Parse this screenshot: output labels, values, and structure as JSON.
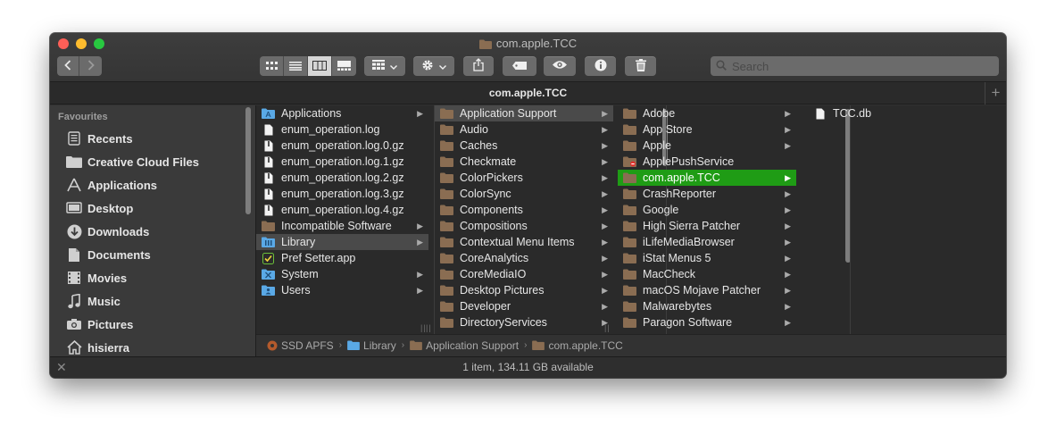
{
  "window": {
    "title": "com.apple.TCC"
  },
  "toolbar": {
    "view_buttons": [
      "icon-view-icon",
      "list-view-icon",
      "column-view-icon",
      "gallery-view-icon"
    ],
    "active_view": "column-view-icon",
    "search_placeholder": "Search"
  },
  "tab": {
    "title": "com.apple.TCC",
    "add": "+"
  },
  "sidebar": {
    "heading": "Favourites",
    "items": [
      {
        "label": "Recents",
        "icon": "clock-icon"
      },
      {
        "label": "Creative Cloud Files",
        "icon": "folder-icon"
      },
      {
        "label": "Applications",
        "icon": "applications-icon"
      },
      {
        "label": "Desktop",
        "icon": "desktop-icon"
      },
      {
        "label": "Downloads",
        "icon": "downloads-icon"
      },
      {
        "label": "Documents",
        "icon": "documents-icon"
      },
      {
        "label": "Movies",
        "icon": "film-icon"
      },
      {
        "label": "Music",
        "icon": "music-note-icon"
      },
      {
        "label": "Pictures",
        "icon": "camera-icon"
      },
      {
        "label": "hisierra",
        "icon": "home-icon"
      }
    ]
  },
  "columns": {
    "col1": [
      {
        "label": "Applications",
        "kind": "app-folder",
        "chevron": true
      },
      {
        "label": "enum_operation.log",
        "kind": "file"
      },
      {
        "label": "enum_operation.log.0.gz",
        "kind": "archive"
      },
      {
        "label": "enum_operation.log.1.gz",
        "kind": "archive"
      },
      {
        "label": "enum_operation.log.2.gz",
        "kind": "archive"
      },
      {
        "label": "enum_operation.log.3.gz",
        "kind": "archive"
      },
      {
        "label": "enum_operation.log.4.gz",
        "kind": "archive"
      },
      {
        "label": "Incompatible Software",
        "kind": "folder",
        "chevron": true
      },
      {
        "label": "Library",
        "kind": "lib-folder",
        "chevron": true,
        "selected": "gray"
      },
      {
        "label": "Pref Setter.app",
        "kind": "app"
      },
      {
        "label": "System",
        "kind": "sys-folder",
        "chevron": true
      },
      {
        "label": "Users",
        "kind": "sys-folder",
        "chevron": true
      }
    ],
    "col2": [
      {
        "label": "Application Support",
        "kind": "folder",
        "chevron": true,
        "selected": "gray"
      },
      {
        "label": "Audio",
        "kind": "folder",
        "chevron": true
      },
      {
        "label": "Caches",
        "kind": "folder",
        "chevron": true
      },
      {
        "label": "Checkmate",
        "kind": "folder",
        "chevron": true
      },
      {
        "label": "ColorPickers",
        "kind": "folder",
        "chevron": true
      },
      {
        "label": "ColorSync",
        "kind": "folder",
        "chevron": true
      },
      {
        "label": "Components",
        "kind": "folder",
        "chevron": true
      },
      {
        "label": "Compositions",
        "kind": "folder",
        "chevron": true
      },
      {
        "label": "Contextual Menu Items",
        "kind": "folder",
        "chevron": true
      },
      {
        "label": "CoreAnalytics",
        "kind": "folder",
        "chevron": true
      },
      {
        "label": "CoreMediaIO",
        "kind": "folder",
        "chevron": true
      },
      {
        "label": "Desktop Pictures",
        "kind": "folder",
        "chevron": true
      },
      {
        "label": "Developer",
        "kind": "folder",
        "chevron": true
      },
      {
        "label": "DirectoryServices",
        "kind": "folder",
        "chevron": true
      }
    ],
    "col3": [
      {
        "label": "Adobe",
        "kind": "folder",
        "chevron": true
      },
      {
        "label": "App Store",
        "kind": "folder",
        "chevron": true
      },
      {
        "label": "Apple",
        "kind": "folder",
        "chevron": true
      },
      {
        "label": "ApplePushService",
        "kind": "restricted-folder"
      },
      {
        "label": "com.apple.TCC",
        "kind": "folder",
        "chevron": true,
        "selected": "green"
      },
      {
        "label": "CrashReporter",
        "kind": "folder",
        "chevron": true
      },
      {
        "label": "Google",
        "kind": "folder",
        "chevron": true
      },
      {
        "label": "High Sierra Patcher",
        "kind": "folder",
        "chevron": true
      },
      {
        "label": "iLifeMediaBrowser",
        "kind": "folder",
        "chevron": true
      },
      {
        "label": "iStat Menus 5",
        "kind": "folder",
        "chevron": true
      },
      {
        "label": "MacCheck",
        "kind": "folder",
        "chevron": true
      },
      {
        "label": "macOS Mojave Patcher",
        "kind": "folder",
        "chevron": true
      },
      {
        "label": "Malwarebytes",
        "kind": "folder",
        "chevron": true
      },
      {
        "label": "Paragon Software",
        "kind": "folder",
        "chevron": true
      }
    ],
    "col4": [
      {
        "label": "TCC.db",
        "kind": "file"
      }
    ]
  },
  "pathbar": [
    {
      "label": "SSD APFS",
      "icon": "disk-icon"
    },
    {
      "label": "Library",
      "icon": "lib-folder"
    },
    {
      "label": "Application Support",
      "icon": "folder"
    },
    {
      "label": "com.apple.TCC",
      "icon": "folder"
    }
  ],
  "status": {
    "text": "1 item, 134.11 GB available"
  },
  "colors": {
    "folder": "#8a6d52",
    "selection_green": "#1f9c15",
    "selection_gray": "#4a4a4a",
    "lib_blue": "#5aa9e6"
  }
}
